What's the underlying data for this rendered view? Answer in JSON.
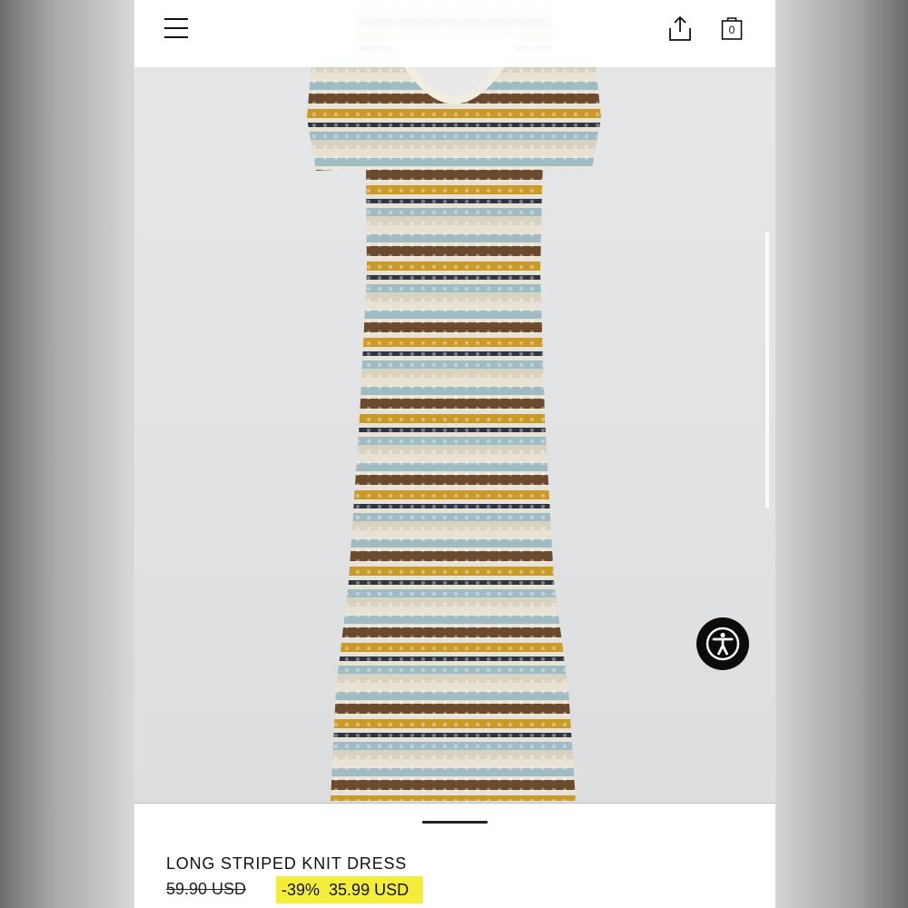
{
  "header": {
    "menu_icon": "hamburger-menu-icon",
    "share_icon": "share-icon",
    "bag_icon": "shopping-bag-icon",
    "bag_count": "0"
  },
  "product": {
    "title": "LONG STRIPED KNIT DRESS",
    "original_price": "59.90 USD",
    "discount": "-39%",
    "sale_price": "35.99 USD"
  },
  "accessibility": {
    "icon": "accessibility-person-icon"
  },
  "colors": {
    "sale_highlight": "#f4ee3a",
    "stripe_brown": "#6b4a2e",
    "stripe_mustard": "#c99a2a",
    "stripe_blue": "#9fbcc4",
    "stripe_cream": "#e8e2d4",
    "stripe_navy": "#2e3440"
  }
}
